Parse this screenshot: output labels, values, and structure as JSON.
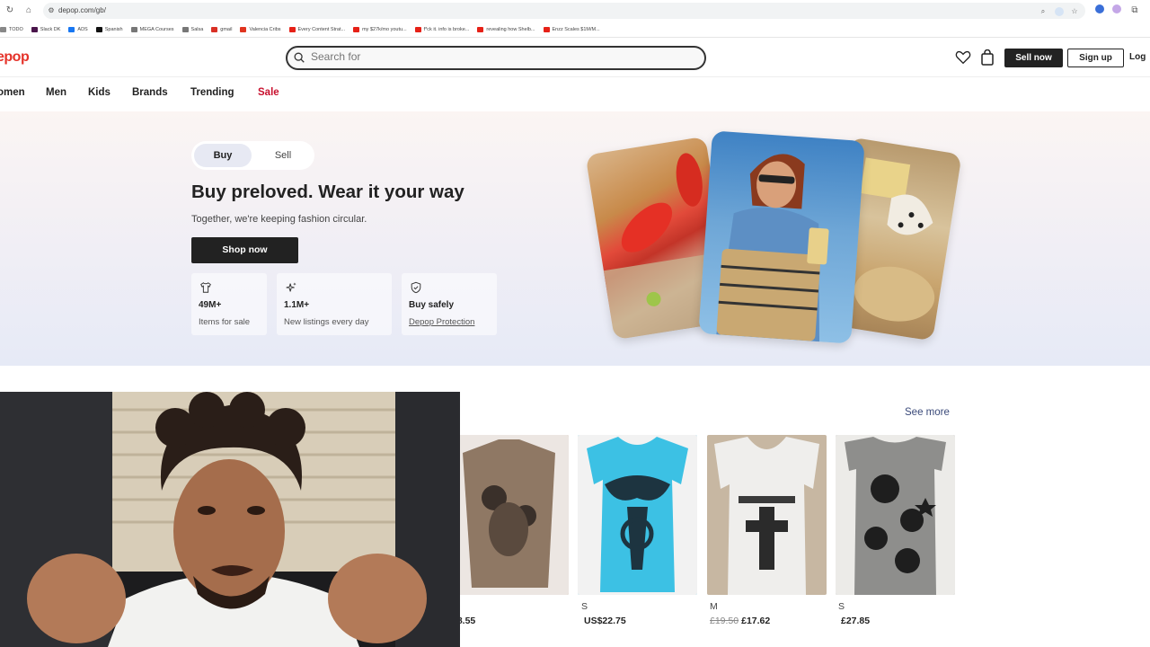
{
  "browser": {
    "url": "depop.com/gb/",
    "bookmarks": [
      "TODO",
      "Slack DK",
      "ADS",
      "Spanish",
      "MEGA Courses",
      "Salsa",
      "gmail",
      "Valencia Cribs",
      "Every Content Strat...",
      "my $27k/mo youtu...",
      "f*ck it. info is broke...",
      "revealing how Shelb...",
      "Enzz Scales $1M/M..."
    ]
  },
  "header": {
    "logo": "epop",
    "search_placeholder": "Search for",
    "sell_now": "Sell now",
    "sign_up": "Sign up",
    "log_in": "Log"
  },
  "categories": [
    "omen",
    "Men",
    "Kids",
    "Brands",
    "Trending",
    "Sale"
  ],
  "hero": {
    "toggle_buy": "Buy",
    "toggle_sell": "Sell",
    "title": "Buy preloved. Wear it your way",
    "subtitle": "Together, we're keeping fashion circular.",
    "cta": "Shop now",
    "stats": [
      {
        "icon": "tshirt-icon",
        "value": "49M+",
        "label": "Items for sale"
      },
      {
        "icon": "sparkle-icon",
        "value": "1.1M+",
        "label": "New listings every day"
      },
      {
        "icon": "shield-icon",
        "value": "Buy safely",
        "label": "Depop Protection"
      }
    ]
  },
  "products_section": {
    "see_more": "See more",
    "items": [
      {
        "size": "",
        "price": "18.55",
        "old_price": ""
      },
      {
        "size": "S",
        "price": "US$22.75",
        "old_price": ""
      },
      {
        "size": "M",
        "price": "£17.62",
        "old_price": "£19.50"
      },
      {
        "size": "S",
        "price": "£27.85",
        "old_price": ""
      }
    ]
  },
  "colors": {
    "brand": "#e5332a",
    "sale": "#c8102e",
    "dark": "#222222",
    "link": "#3b4a7a"
  }
}
